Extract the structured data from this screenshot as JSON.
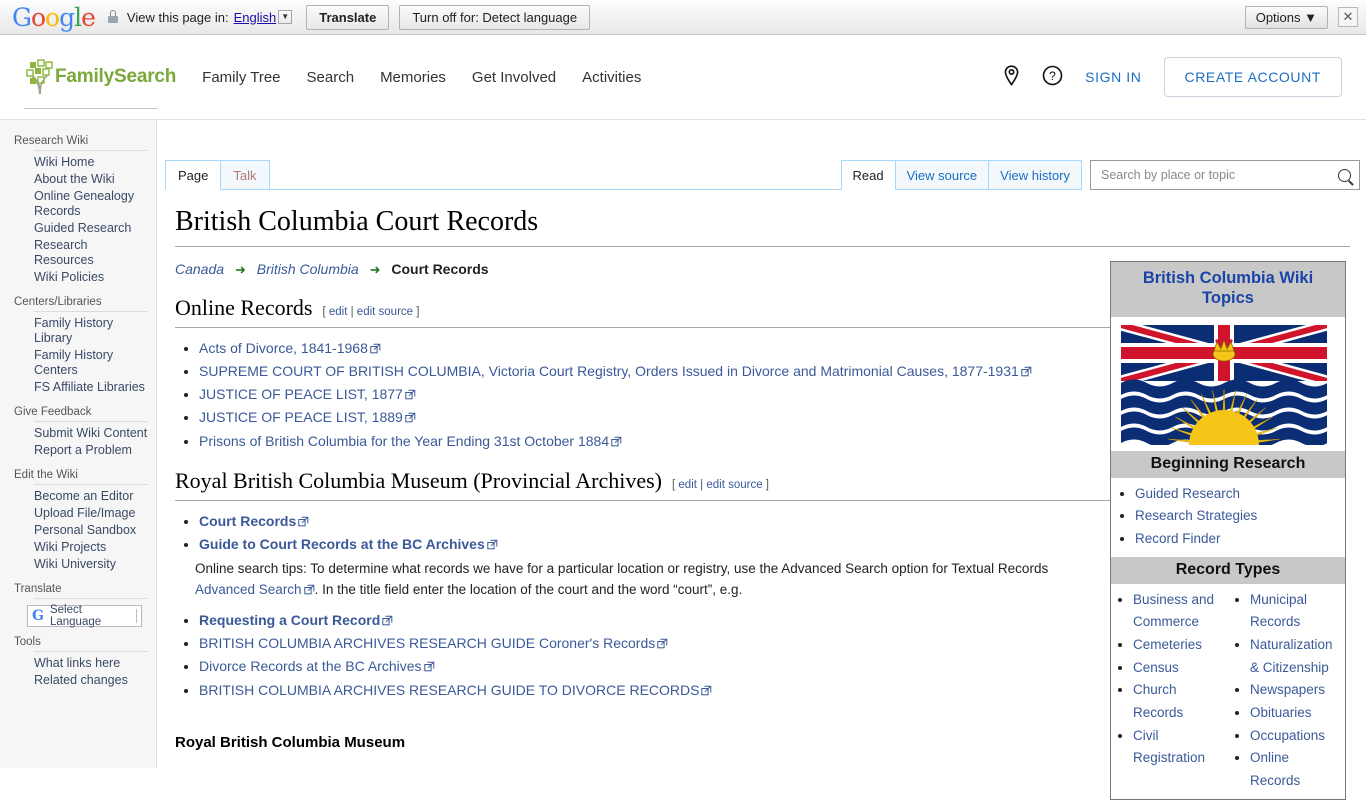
{
  "translate_bar": {
    "logo": "Google",
    "view_label": "View this page in:",
    "language": "English",
    "translate_button": "Translate",
    "turn_off_button": "Turn off for: Detect language",
    "options_button": "Options",
    "close_label": "✕"
  },
  "header": {
    "logo_text": "FamilySearch",
    "nav": [
      {
        "label": "Family Tree"
      },
      {
        "label": "Search"
      },
      {
        "label": "Memories"
      },
      {
        "label": "Get Involved"
      },
      {
        "label": "Activities"
      }
    ],
    "sign_in": "SIGN IN",
    "create_account": "CREATE ACCOUNT"
  },
  "sidebar": {
    "groups": [
      {
        "title": "Research Wiki",
        "items": [
          "Wiki Home",
          "About the Wiki",
          "Online Genealogy Records",
          "Guided Research",
          "Research Resources",
          "Wiki Policies"
        ]
      },
      {
        "title": "Centers/Libraries",
        "items": [
          "Family History Library",
          "Family History Centers",
          "FS Affiliate Libraries"
        ]
      },
      {
        "title": "Give Feedback",
        "items": [
          "Submit Wiki Content",
          "Report a Problem"
        ]
      },
      {
        "title": "Edit the Wiki",
        "items": [
          "Become an Editor",
          "Upload File/Image",
          "Personal Sandbox",
          "Wiki Projects",
          "Wiki University"
        ]
      }
    ],
    "translate_title": "Translate",
    "translate_widget_label": "Select Language",
    "tools_title": "Tools",
    "tools_items": [
      "What links here",
      "Related changes"
    ]
  },
  "tabs": {
    "left": [
      {
        "label": "Page",
        "active": true
      },
      {
        "label": "Talk",
        "active": false
      }
    ],
    "right": [
      {
        "label": "Read",
        "active": true
      },
      {
        "label": "View source",
        "active": false
      },
      {
        "label": "View history",
        "active": false
      }
    ]
  },
  "search": {
    "placeholder": "Search by place or topic",
    "value": ""
  },
  "page": {
    "title": "British Columbia Court Records",
    "breadcrumb": {
      "items": [
        "Canada",
        "British Columbia"
      ],
      "current": "Court Records",
      "separator": "➜"
    },
    "edit_label": "edit",
    "edit_source_label": "edit source",
    "sections": [
      {
        "heading": "Online Records",
        "links": [
          {
            "text": "Acts of Divorce, 1841-1968",
            "external": true,
            "bold": false
          },
          {
            "text": "SUPREME COURT OF BRITISH COLUMBIA, Victoria Court Registry, Orders Issued in Divorce and Matrimonial Causes, 1877-1931",
            "external": true,
            "bold": false
          },
          {
            "text": "JUSTICE OF PEACE LIST, 1877",
            "external": true,
            "bold": false
          },
          {
            "text": "JUSTICE OF PEACE LIST, 1889",
            "external": true,
            "bold": false
          },
          {
            "text": "Prisons of British Columbia for the Year Ending 31st October 1884",
            "external": true,
            "bold": false
          }
        ]
      },
      {
        "heading": "Royal British Columbia Museum (Provincial Archives)",
        "links": [
          {
            "text": "Court Records",
            "external": true,
            "bold": true
          },
          {
            "text": "Guide to Court Records at the BC Archives",
            "external": true,
            "bold": true
          }
        ],
        "note_before": "Online search tips: To determine what records we have for a particular location or registry, use the Advanced Search option for Textual Records ",
        "note_link": "Advanced Search",
        "note_after": ". In the title field enter the location of the court and the word “court”, e.g.",
        "links_after": [
          {
            "text": "Requesting a Court Record",
            "external": true,
            "bold": true
          },
          {
            "text": "BRITISH COLUMBIA ARCHIVES RESEARCH GUIDE Coroner's Records",
            "external": true,
            "bold": false
          },
          {
            "text": "Divorce Records at the BC Archives",
            "external": true,
            "bold": false
          },
          {
            "text": "BRITISH COLUMBIA ARCHIVES RESEARCH GUIDE TO DIVORCE RECORDS",
            "external": true,
            "bold": false
          }
        ]
      }
    ],
    "subsection_heading": "Royal British Columbia Museum"
  },
  "infobox": {
    "title": "British Columbia Wiki Topics",
    "flag_alt": "Flag of British Columbia",
    "beginning_research_header": "Beginning Research",
    "beginning_research_items": [
      "Guided Research",
      "Research Strategies",
      "Record Finder"
    ],
    "record_types_header": "Record Types",
    "record_types_col1": [
      "Business and Commerce",
      "Cemeteries",
      "Census",
      "Church Records",
      "Civil Registration"
    ],
    "record_types_col2": [
      "Municipal Records",
      "Naturalization & Citizenship",
      "Newspapers",
      "Obituaries",
      "Occupations",
      "Online Records"
    ]
  },
  "colors": {
    "link": "#3b5998",
    "fs_green": "#7aa83a",
    "fs_blue": "#1b6ec2",
    "infobox_header_bg": "#c8c8c8",
    "infobox_title_color": "#1b44a8",
    "tab_border": "#a7d7f9"
  }
}
